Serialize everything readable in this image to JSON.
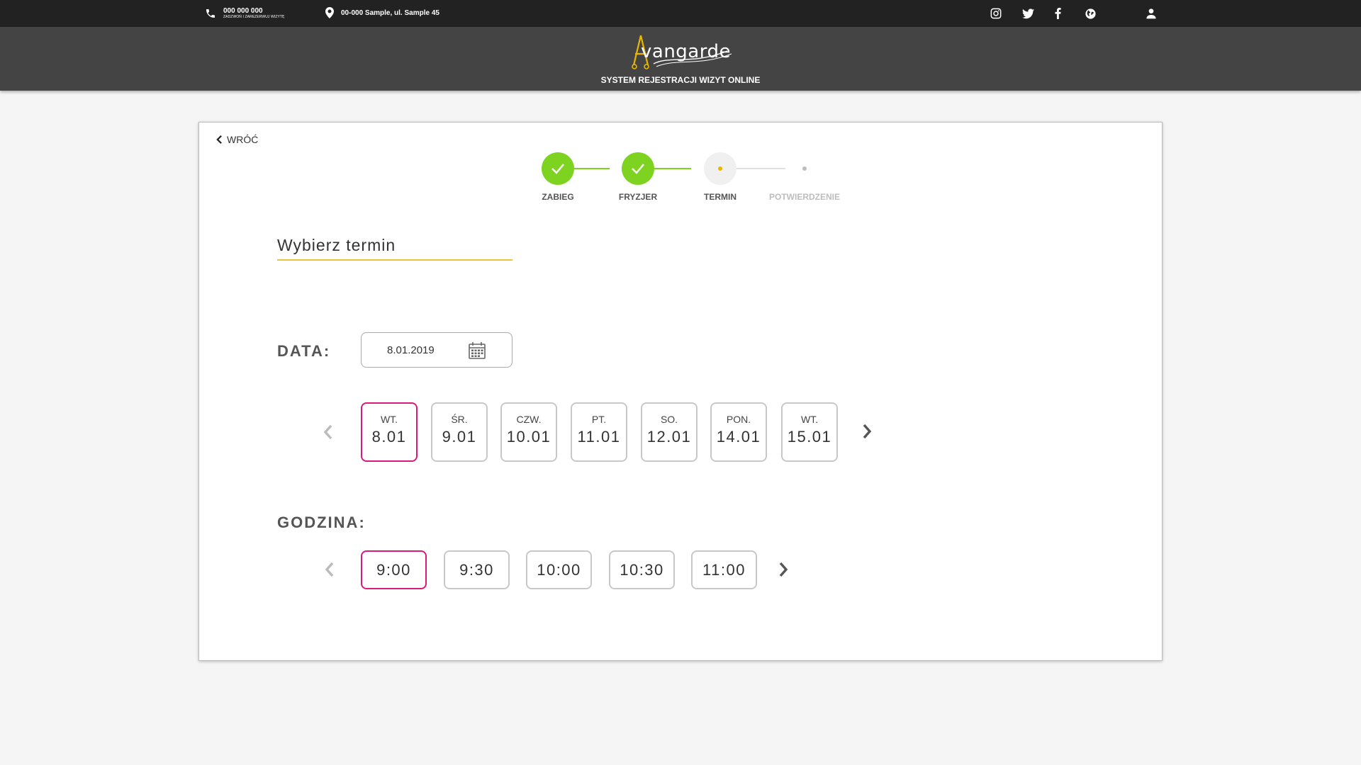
{
  "topbar": {
    "phone": "000 000 000",
    "phone_sub": "ZADZWOŃ I ZAREZERWUJ WIZYTĘ",
    "address": "00-000 Sample, ul. Sample 45"
  },
  "header": {
    "logo_text": "vangarde",
    "subtitle": "SYSTEM REJESTRACJI WIZYT ONLINE"
  },
  "back_label": "WRÓĆ",
  "steps": [
    {
      "label": "ZABIEG",
      "state": "done"
    },
    {
      "label": "FRYZJER",
      "state": "done"
    },
    {
      "label": "TERMIN",
      "state": "current"
    },
    {
      "label": "POTWIERDZENIE",
      "state": "future"
    }
  ],
  "title": "Wybierz termin",
  "date_label": "DATA:",
  "date_value": "8.01.2019",
  "days": [
    {
      "name": "WT.",
      "date": "8.01",
      "selected": true
    },
    {
      "name": "ŚR.",
      "date": "9.01"
    },
    {
      "name": "CZW.",
      "date": "10.01"
    },
    {
      "name": "PT.",
      "date": "11.01"
    },
    {
      "name": "SO.",
      "date": "12.01"
    },
    {
      "name": "PON.",
      "date": "14.01"
    },
    {
      "name": "WT.",
      "date": "15.01"
    }
  ],
  "hour_label": "GODZINA:",
  "times": [
    {
      "label": "9:00",
      "selected": true
    },
    {
      "label": "9:30"
    },
    {
      "label": "10:00"
    },
    {
      "label": "10:30"
    },
    {
      "label": "11:00"
    }
  ],
  "colors": {
    "accent_selected": "#d81b79",
    "step_done": "#7ed321",
    "underline": "#e8c43c",
    "logo_gold": "#e8b800"
  }
}
